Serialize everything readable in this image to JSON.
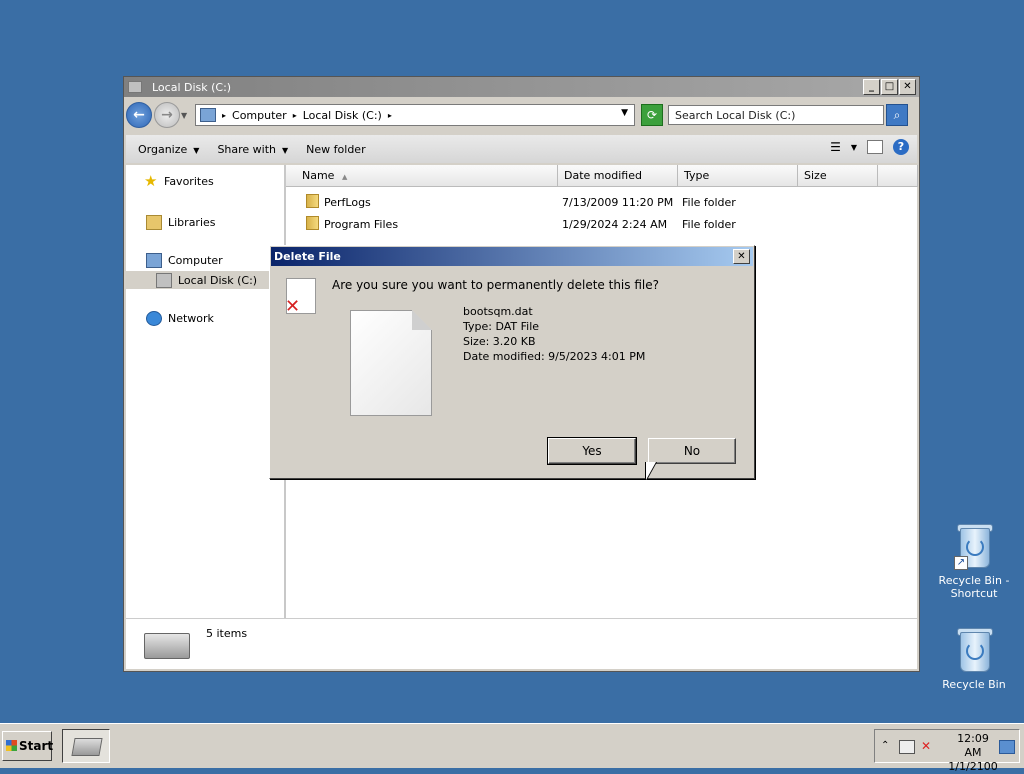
{
  "desktop": {
    "icons": [
      {
        "label_line1": "Recycle Bin -",
        "label_line2": "Shortcut"
      },
      {
        "label_line1": "Recycle Bin",
        "label_line2": ""
      }
    ]
  },
  "explorer": {
    "title": "Local Disk (C:)",
    "breadcrumb": [
      "Computer",
      "Local Disk (C:)"
    ],
    "search_placeholder": "Search Local Disk (C:)",
    "toolbar": {
      "organize": "Organize",
      "share_with": "Share with",
      "new_folder": "New folder"
    },
    "nav": {
      "favorites": "Favorites",
      "libraries": "Libraries",
      "computer": "Computer",
      "local_disk": "Local Disk (C:)",
      "network": "Network"
    },
    "columns": {
      "name": "Name",
      "date_modified": "Date modified",
      "type": "Type",
      "size": "Size"
    },
    "files": [
      {
        "name": "PerfLogs",
        "date": "7/13/2009 11:20 PM",
        "type": "File folder",
        "size": ""
      },
      {
        "name": "Program Files",
        "date": "1/29/2024 2:24 AM",
        "type": "File folder",
        "size": ""
      }
    ],
    "status": "5 items"
  },
  "dialog": {
    "title": "Delete File",
    "close_glyph": "✕",
    "question": "Are you sure you want to permanently delete this file?",
    "file_name": "bootsqm.dat",
    "file_type": "Type: DAT File",
    "file_size": "Size: 3.20 KB",
    "file_date": "Date modified: 9/5/2023 4:01 PM",
    "yes": "Yes",
    "no": "No"
  },
  "taskbar": {
    "start": "Start",
    "clock_time": "12:09 AM",
    "clock_date": "1/1/2100"
  }
}
